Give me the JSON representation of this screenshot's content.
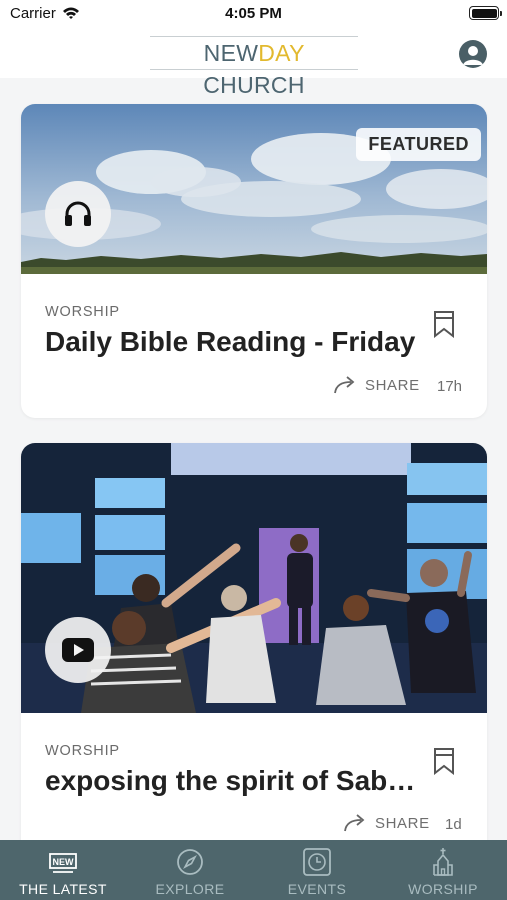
{
  "status_bar": {
    "carrier": "Carrier",
    "time": "4:05 PM"
  },
  "header": {
    "logo": {
      "part1": "NEW",
      "part2": "DAY",
      "part3": " CHURCH"
    },
    "colors": {
      "logo_primary": "#4d6570",
      "logo_accent": "#e2b92e"
    }
  },
  "feed": {
    "cards": [
      {
        "badge": "FEATURED",
        "category": "WORSHIP",
        "title": "Daily Bible Reading - Friday",
        "share_label": "SHARE",
        "time": "17h",
        "media_icon": "headphones-icon"
      },
      {
        "category": "WORSHIP",
        "title": "exposing the spirit of Sabbath",
        "share_label": "SHARE",
        "time": "1d",
        "media_icon": "play-video-icon"
      }
    ]
  },
  "tab_bar": {
    "background": "#4e666c",
    "tabs": [
      {
        "label": "THE LATEST",
        "icon": "new-badge-icon",
        "active": true
      },
      {
        "label": "EXPLORE",
        "icon": "compass-icon",
        "active": false
      },
      {
        "label": "EVENTS",
        "icon": "clock-icon",
        "active": false
      },
      {
        "label": "WORSHIP",
        "icon": "church-icon",
        "active": false
      }
    ]
  }
}
